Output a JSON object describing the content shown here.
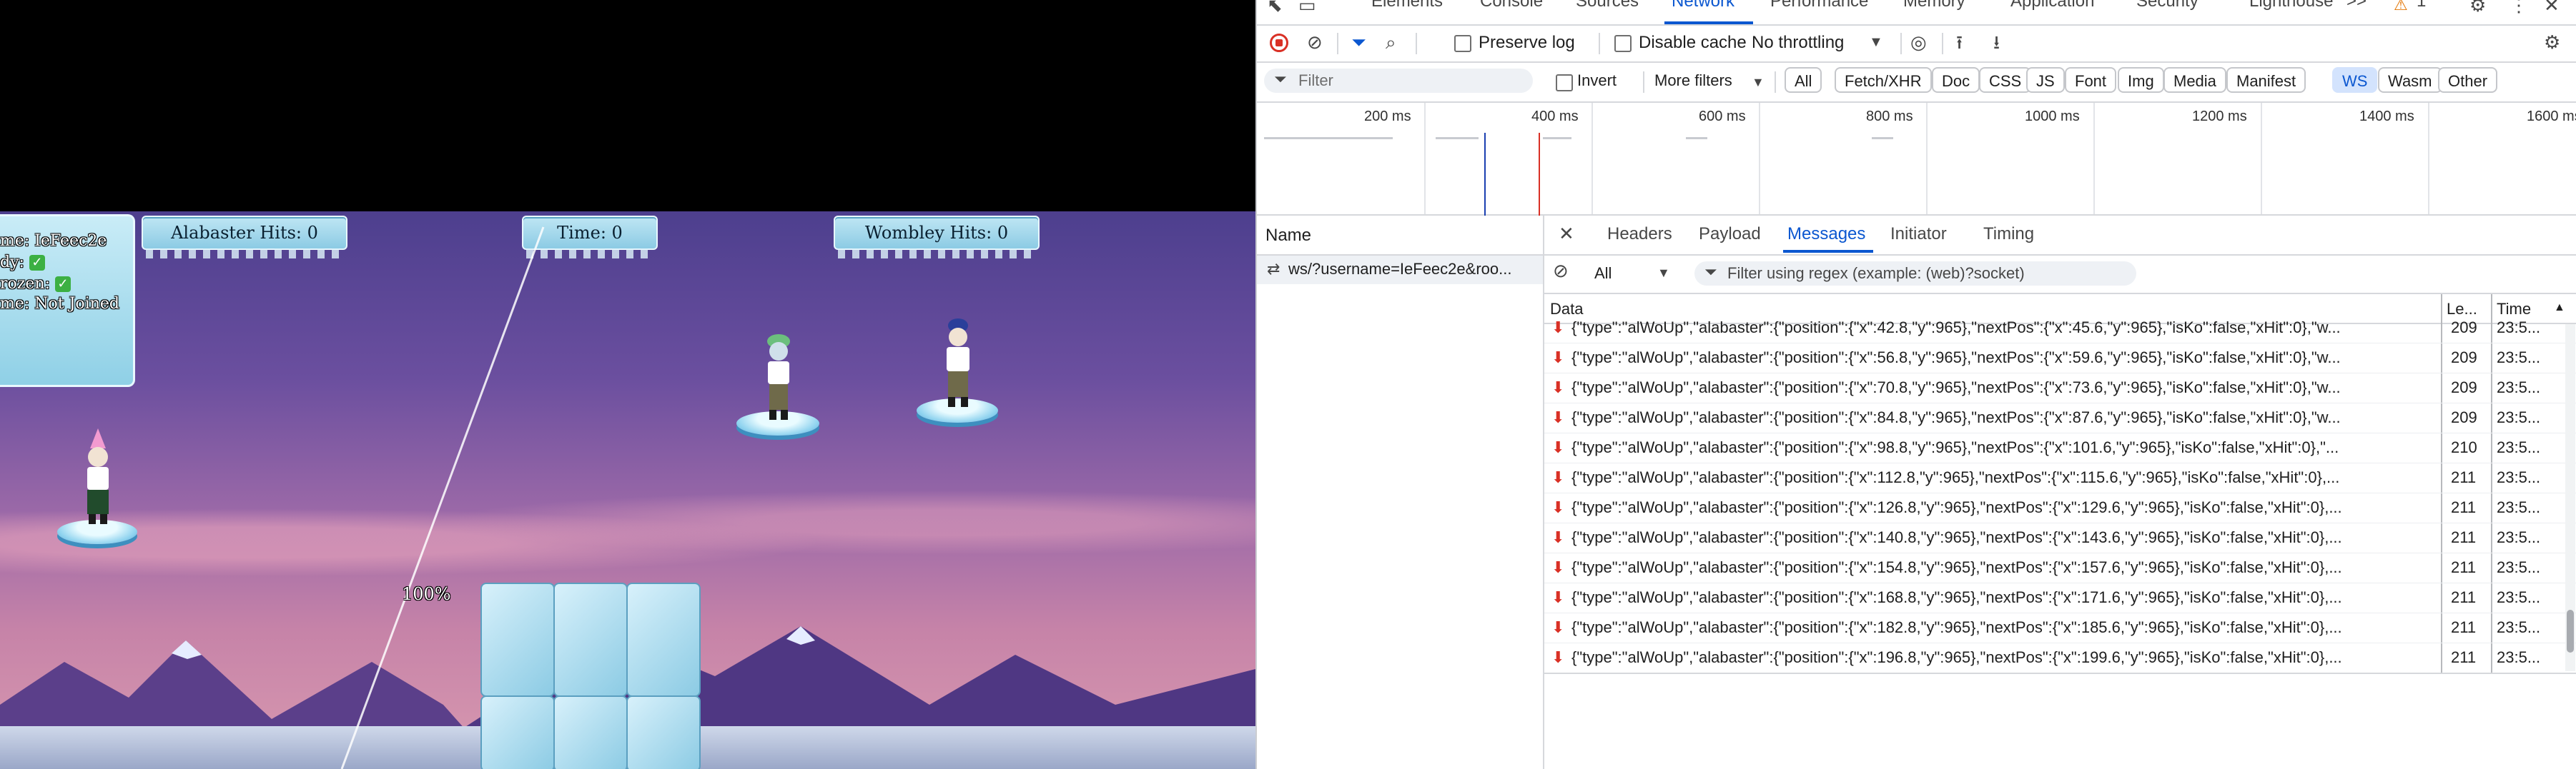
{
  "game": {
    "banners": {
      "alabaster": "Alabaster Hits: 0",
      "time": "Time: 0",
      "wombley": "Wombley Hits: 0"
    },
    "status": {
      "name": "me: IeFeec2e",
      "ready": "dy:",
      "frozen": "rozen:",
      "team": "me: Not Joined",
      "ready_icon": "check-icon",
      "frozen_icon": "check-icon"
    },
    "power_percent": "100%"
  },
  "devtools": {
    "main_tabs": [
      "Elements",
      "Console",
      "Sources",
      "Network",
      "Performance",
      "Memory",
      "Application",
      "Security",
      "Lighthouse"
    ],
    "active_tab": "Network",
    "more_tabs": ">>",
    "warning_count": "1",
    "toolbar": {
      "preserve_log": "Preserve log",
      "disable_cache": "Disable cache",
      "throttling": "No throttling"
    },
    "filter": {
      "placeholder": "Filter",
      "invert": "Invert",
      "more_filters": "More filters",
      "types": [
        "All",
        "Fetch/XHR",
        "Doc",
        "CSS",
        "JS",
        "Font",
        "Img",
        "Media",
        "Manifest",
        "WS",
        "Wasm",
        "Other"
      ],
      "selected_type": "WS"
    },
    "timeline": {
      "ticks": [
        "200 ms",
        "400 ms",
        "600 ms",
        "800 ms",
        "1000 ms",
        "1200 ms",
        "1400 ms",
        "1600 ms"
      ]
    },
    "requests": {
      "header": "Name",
      "items": [
        {
          "name": "ws/?username=IeFeec2e&roo..."
        }
      ]
    },
    "detail_tabs": [
      "Headers",
      "Payload",
      "Messages",
      "Initiator",
      "Timing"
    ],
    "active_detail_tab": "Messages",
    "messages": {
      "type_filter": "All",
      "regex_placeholder": "Filter using regex (example: (web)?socket)",
      "columns": {
        "data": "Data",
        "length": "Le...",
        "time": "Time"
      },
      "rows": [
        {
          "data": "{\"type\":\"alWoUp\",\"alabaster\":{\"position\":{\"x\":42.8,\"y\":965},\"nextPos\":{\"x\":45.6,\"y\":965},\"isKo\":false,\"xHit\":0},\"w...",
          "length": "209",
          "time": "23:5..."
        },
        {
          "data": "{\"type\":\"alWoUp\",\"alabaster\":{\"position\":{\"x\":56.8,\"y\":965},\"nextPos\":{\"x\":59.6,\"y\":965},\"isKo\":false,\"xHit\":0},\"w...",
          "length": "209",
          "time": "23:5..."
        },
        {
          "data": "{\"type\":\"alWoUp\",\"alabaster\":{\"position\":{\"x\":70.8,\"y\":965},\"nextPos\":{\"x\":73.6,\"y\":965},\"isKo\":false,\"xHit\":0},\"w...",
          "length": "209",
          "time": "23:5..."
        },
        {
          "data": "{\"type\":\"alWoUp\",\"alabaster\":{\"position\":{\"x\":84.8,\"y\":965},\"nextPos\":{\"x\":87.6,\"y\":965},\"isKo\":false,\"xHit\":0},\"w...",
          "length": "209",
          "time": "23:5..."
        },
        {
          "data": "{\"type\":\"alWoUp\",\"alabaster\":{\"position\":{\"x\":98.8,\"y\":965},\"nextPos\":{\"x\":101.6,\"y\":965},\"isKo\":false,\"xHit\":0},\"...",
          "length": "210",
          "time": "23:5..."
        },
        {
          "data": "{\"type\":\"alWoUp\",\"alabaster\":{\"position\":{\"x\":112.8,\"y\":965},\"nextPos\":{\"x\":115.6,\"y\":965},\"isKo\":false,\"xHit\":0},...",
          "length": "211",
          "time": "23:5..."
        },
        {
          "data": "{\"type\":\"alWoUp\",\"alabaster\":{\"position\":{\"x\":126.8,\"y\":965},\"nextPos\":{\"x\":129.6,\"y\":965},\"isKo\":false,\"xHit\":0},...",
          "length": "211",
          "time": "23:5..."
        },
        {
          "data": "{\"type\":\"alWoUp\",\"alabaster\":{\"position\":{\"x\":140.8,\"y\":965},\"nextPos\":{\"x\":143.6,\"y\":965},\"isKo\":false,\"xHit\":0},...",
          "length": "211",
          "time": "23:5..."
        },
        {
          "data": "{\"type\":\"alWoUp\",\"alabaster\":{\"position\":{\"x\":154.8,\"y\":965},\"nextPos\":{\"x\":157.6,\"y\":965},\"isKo\":false,\"xHit\":0},...",
          "length": "211",
          "time": "23:5..."
        },
        {
          "data": "{\"type\":\"alWoUp\",\"alabaster\":{\"position\":{\"x\":168.8,\"y\":965},\"nextPos\":{\"x\":171.6,\"y\":965},\"isKo\":false,\"xHit\":0},...",
          "length": "211",
          "time": "23:5..."
        },
        {
          "data": "{\"type\":\"alWoUp\",\"alabaster\":{\"position\":{\"x\":182.8,\"y\":965},\"nextPos\":{\"x\":185.6,\"y\":965},\"isKo\":false,\"xHit\":0},...",
          "length": "211",
          "time": "23:5..."
        },
        {
          "data": "{\"type\":\"alWoUp\",\"alabaster\":{\"position\":{\"x\":196.8,\"y\":965},\"nextPos\":{\"x\":199.6,\"y\":965},\"isKo\":false,\"xHit\":0},...",
          "length": "211",
          "time": "23:5..."
        }
      ]
    },
    "colors": {
      "accent": "#0b57d0",
      "record": "#d93025",
      "selected_pill": "#d3e3fd"
    }
  }
}
